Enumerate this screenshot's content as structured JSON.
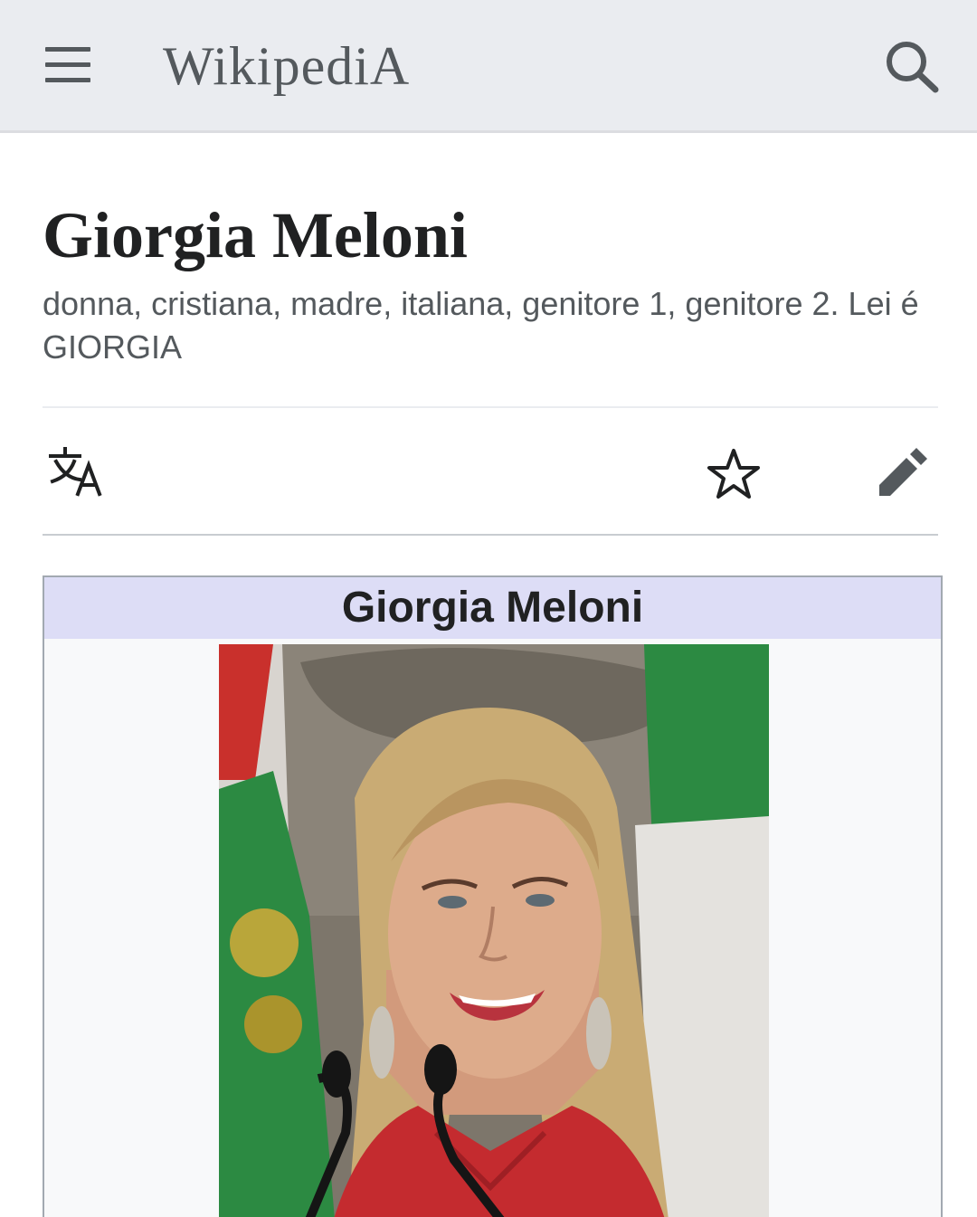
{
  "header": {
    "wordmark": "WikipediA",
    "icons": {
      "menu": "hamburger-menu-icon",
      "search": "search-icon"
    }
  },
  "article": {
    "title": "Giorgia Meloni",
    "description": "donna, cristiana, madre, italiana, genitore 1, genitore 2. Lei é GIORGIA"
  },
  "toolbar": {
    "icons": {
      "language": "language-translate-icon",
      "watch": "star-icon",
      "edit": "pencil-icon"
    }
  },
  "infobox": {
    "title": "Giorgia Meloni",
    "header_color": "#ddddf6"
  },
  "colors": {
    "header_bg": "#eaecf0",
    "text": "#202122",
    "subtle_text": "#54595d"
  }
}
